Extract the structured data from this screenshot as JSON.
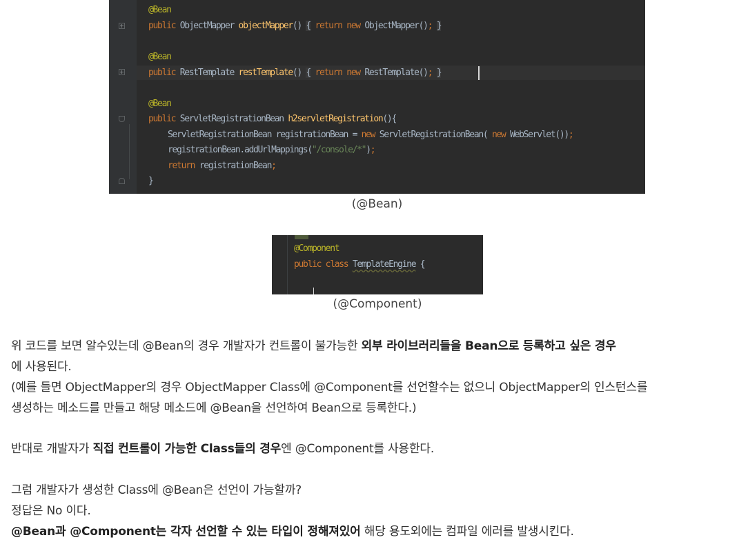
{
  "code_bean": {
    "lines": [
      {
        "tokens": [
          {
            "t": "@Bean",
            "c": "ann"
          }
        ]
      },
      {
        "tokens": [
          {
            "t": "public ",
            "c": "kw"
          },
          {
            "t": "ObjectMapper "
          },
          {
            "t": "objectMapper",
            "c": "fn"
          },
          {
            "t": "() "
          },
          {
            "t": "{",
            "c": "fold-brace"
          },
          {
            "t": " return new ",
            "c": "kw"
          },
          {
            "t": "ObjectMapper()"
          },
          {
            "t": ";",
            "c": "kw"
          },
          {
            "t": " "
          },
          {
            "t": "}",
            "c": "fold-brace"
          }
        ]
      },
      {
        "tokens": [
          {
            "t": "@Bean",
            "c": "ann"
          }
        ]
      },
      {
        "tokens": [
          {
            "t": "public ",
            "c": "kw"
          },
          {
            "t": "RestTemplate "
          },
          {
            "t": "restTemplate",
            "c": "fn"
          },
          {
            "t": "() "
          },
          {
            "t": "{",
            "c": "fold-brace"
          },
          {
            "t": " return new ",
            "c": "kw"
          },
          {
            "t": "RestTemplate()"
          },
          {
            "t": ";",
            "c": "kw"
          },
          {
            "t": " "
          },
          {
            "t": "}",
            "c": "fold-brace"
          }
        ]
      },
      {
        "tokens": [
          {
            "t": "@Bean",
            "c": "ann"
          }
        ]
      },
      {
        "tokens": [
          {
            "t": "public ",
            "c": "kw"
          },
          {
            "t": "ServletRegistrationBean "
          },
          {
            "t": "h2servletRegistration",
            "c": "fn"
          },
          {
            "t": "(){"
          }
        ]
      },
      {
        "tokens": [
          {
            "t": "ServletRegistrationBean registrationBean = "
          },
          {
            "t": "new ",
            "c": "kw"
          },
          {
            "t": "ServletRegistrationBean( "
          },
          {
            "t": "new ",
            "c": "kw"
          },
          {
            "t": "WebServlet())"
          },
          {
            "t": ";",
            "c": "kw"
          }
        ]
      },
      {
        "tokens": [
          {
            "t": "registrationBean.addUrlMappings("
          },
          {
            "t": "\"/console/*\"",
            "c": "str"
          },
          {
            "t": ")"
          },
          {
            "t": ";",
            "c": "kw"
          }
        ]
      },
      {
        "tokens": [
          {
            "t": "return ",
            "c": "kw"
          },
          {
            "t": "registrationBean"
          },
          {
            "t": ";",
            "c": "kw"
          }
        ]
      },
      {
        "tokens": [
          {
            "t": "}"
          }
        ]
      }
    ]
  },
  "caption_bean": "(@Bean)",
  "code_component": {
    "lines": [
      {
        "tokens": [
          {
            "t": "@Component",
            "c": "ann"
          }
        ]
      },
      {
        "tokens": [
          {
            "t": "public class ",
            "c": "kw"
          },
          {
            "t": "TemplateEngine",
            "c": "tpl"
          },
          {
            "t": " {"
          }
        ]
      }
    ]
  },
  "caption_component": "(@Component)",
  "paragraphs": [
    [
      {
        "t": "위 코드를 보면 알수있는데 @Bean의 경우 개발자가 컨트롤이 불가능한 "
      },
      {
        "t": "외부 라이브러리들을 Bean으로 등록하고 싶은 경우",
        "b": true
      }
    ],
    [
      {
        "t": "에 사용된다."
      }
    ],
    [
      {
        "t": "(예를 들면 ObjectMapper의 경우 ObjectMapper Class에 @Component를 선언할수는 없으니 ObjectMapper의 인스턴스를"
      }
    ],
    [
      {
        "t": "생성하는 메소드를 만들고 해당 메소드에 @Bean을 선언하여 Bean으로 등록한다.)"
      }
    ],
    [
      {
        "t": "반대로 개발자가 "
      },
      {
        "t": "직접 컨트롤이 가능한 Class들의 경우",
        "b": true
      },
      {
        "t": "엔 @Component를 사용한다."
      }
    ],
    [
      {
        "t": "그럼 개발자가 생성한 Class에 @Bean은 선언이 가능할까?"
      }
    ],
    [
      {
        "t": "정답은 No 이다."
      }
    ],
    [
      {
        "t": "@Bean과 @Component는 각자 선언할 수 있는 타입이 정해져있어",
        "b": true
      },
      {
        "t": " 해당 용도외에는 컴파일 에러를 발생시킨다."
      }
    ]
  ]
}
